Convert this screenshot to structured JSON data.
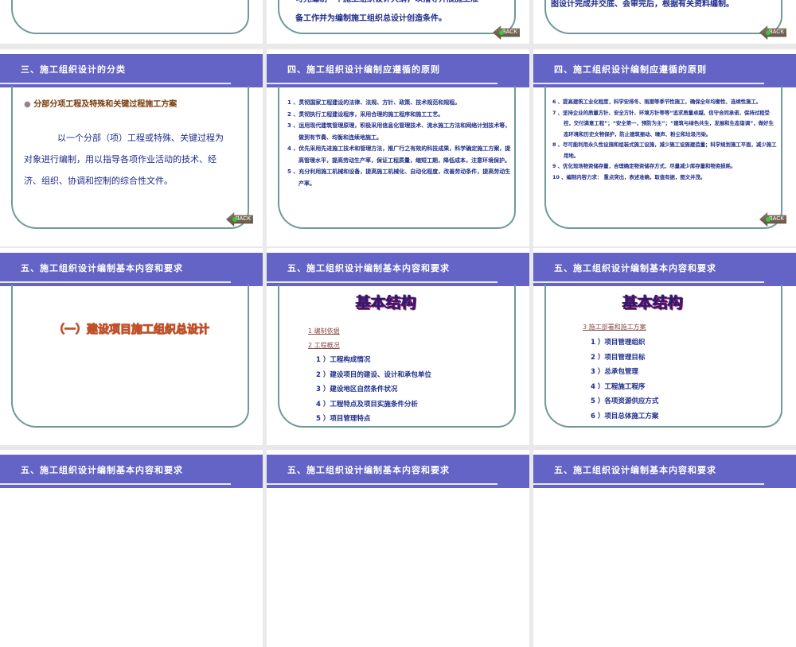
{
  "back_label": "BACK",
  "slides": {
    "s2_partial": [
      "可先编制一个施工组织设计大纲，以指导开展施工准",
      "备工作并为编制施工组织总设计创造条件。"
    ],
    "s3_partial": "图设计完成并交底、会审完后，根据有关资料编制。",
    "s4": {
      "title": "三、施工组织设计的分类",
      "bullet": "分部分项工程及特殊和关键过程施工方案",
      "body": "以一个分部（项）工程或特殊、关键过程为对象进行编制，用以指导各项作业活动的技术、经济、组织、协调和控制的综合性文件。"
    },
    "s5": {
      "title": "四、施工组织设计编制应遵循的原则",
      "items": [
        "1 、贯彻国家工程建设的法律、法规、方针、政策、技术规范和规程。",
        "2 、贯彻执行工程建设程序，采用合理的施工程序和施工工艺。",
        "3 、运用现代建筑管理原理，积极采用信息化管理技术、流水施工方法和网络计划技术等，做到有节奏、均衡和连续地施工。",
        "4 、优先采用先进施工技术和管理方法，推广行之有效的科技成果，科学确定施工方案，提高管理水平，提高劳动生产率，保证工程质量，缩短工期，降低成本，注意环境保护。",
        "5 、充分利用施工机械和设备，提高施工机械化、自动化程度，改善劳动条件，提高劳动生产率。"
      ]
    },
    "s6": {
      "title": "四、施工组织设计编制应遵循的原则",
      "items": [
        "6 、提高建筑工业化程度，科学安排冬、雨期等季节性施工，确保全年均衡性、连续性施工。",
        "7 、坚持企业的质量方针、安全方针、环境方针等等“追求质量卓越，信守合同承诺，保持过程受控，交付满意工程”；“安全第一，预防为主”；“建筑与绿色共生，发展和生态谐调”，做好生态环境和历史文物保护，防止建筑振动、噪声、粉尘和垃圾污染。",
        "8 、尽可能利用永久性设施和组装式施工设施，减少施工设施建造量；科学规划施工平面，减少施工用地。",
        "9 、优化现场物资储存量，合理确定物资储存方式，尽量减少库存量和物资损耗。",
        "10 、编制内容力求：  重点突出，表述准确，取值有据，图文并茂。"
      ]
    },
    "s7": {
      "title": "五、施工组织设计编制基本内容和要求",
      "heading": "（一）建设项目施工组织总设计"
    },
    "s8": {
      "title": "五、施工组织设计编制基本内容和要求",
      "heading": "基本结构",
      "links": [
        "1   编制依据",
        "2   工程概况"
      ],
      "items": [
        "1 ）工程构成情况",
        "2 ）建设项目的建设、设计和承包单位",
        "3 ）建设地区自然条件状况",
        "4 ）工程特点及项目实施条件分析",
        "5 ）项目管理特点"
      ]
    },
    "s9": {
      "title": "五、施工组织设计编制基本内容和要求",
      "heading": "基本结构",
      "link": "3   施工部署和施工方案",
      "items": [
        "1 ）项目管理组织",
        "2 ）项目管理目标",
        "3 ）总承包管理",
        "4 ）工程施工程序",
        "5 ）各项资源供应方式",
        "6 ）项目总体施工方案"
      ]
    },
    "row4_titles": [
      "五、施工组织设计编制基本内容和要求",
      "五、施工组织设计编制基本内容和要求",
      "五、施工组织设计编制基本内容和要求"
    ]
  }
}
